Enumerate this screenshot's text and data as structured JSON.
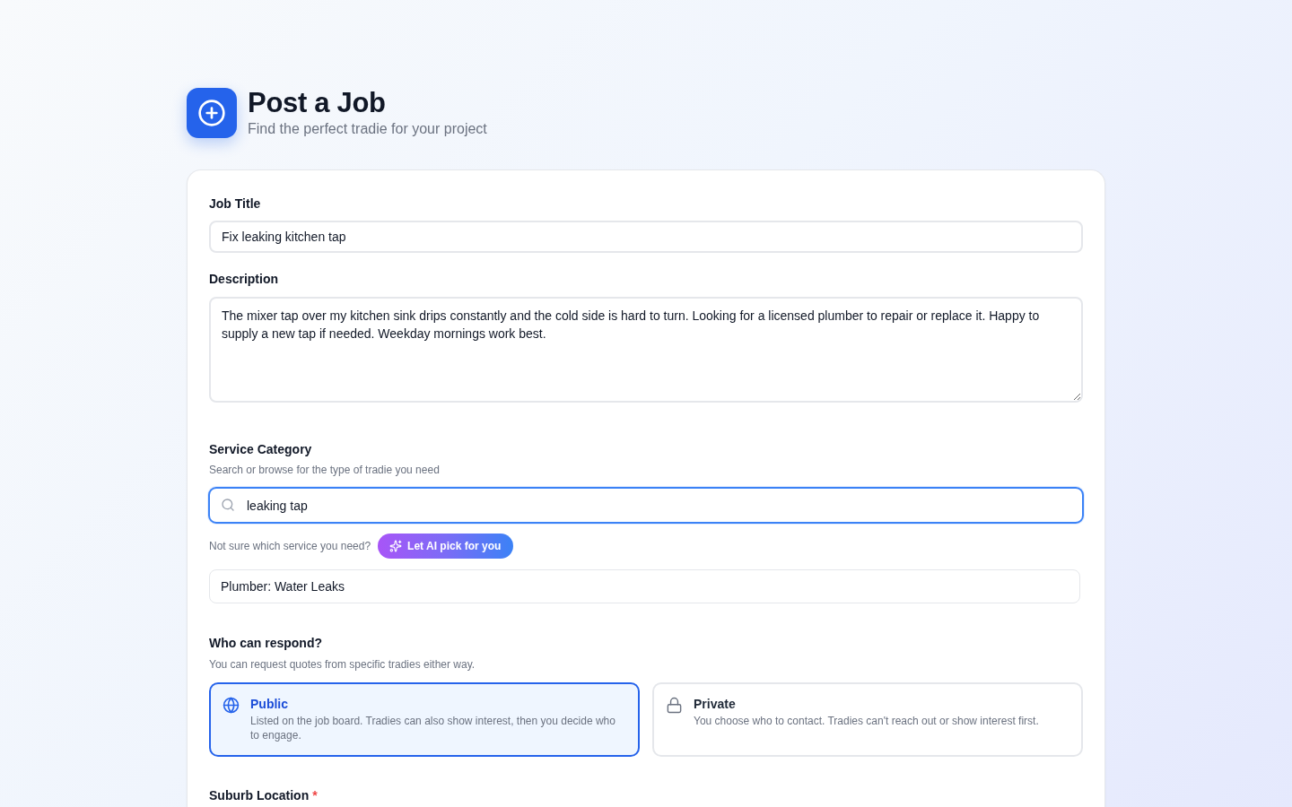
{
  "header": {
    "title": "Post a Job",
    "subtitle": "Find the perfect tradie for your project"
  },
  "form": {
    "job_title": {
      "label": "Job Title",
      "value": "Fix leaking kitchen tap"
    },
    "description": {
      "label": "Description",
      "value": "The mixer tap over my kitchen sink drips constantly and the cold side is hard to turn. Looking for a licensed plumber to repair or replace it. Happy to supply a new tap if needed. Weekday mornings work best."
    },
    "service_category": {
      "label": "Service Category",
      "hint": "Search or browse for the type of tradie you need",
      "search": {
        "value": "leaking tap",
        "focused": true
      },
      "ai_prompt": "Not sure which service you need?",
      "ai_button": "Let AI pick for you",
      "selected_service": "Plumber: Water Leaks"
    },
    "who_can_respond": {
      "label": "Who can respond?",
      "hint": "You can request quotes from specific tradies either way.",
      "options": [
        {
          "kind": "public",
          "title": "Public",
          "description": "Listed on the job board. Tradies can also show interest, then you decide who to engage.",
          "selected": true
        },
        {
          "kind": "private",
          "title": "Private",
          "description": "You choose who to contact. Tradies can't reach out or show interest first.",
          "selected": false
        }
      ]
    },
    "suburb_location": {
      "label": "Suburb Location",
      "required_mark": "*"
    }
  }
}
